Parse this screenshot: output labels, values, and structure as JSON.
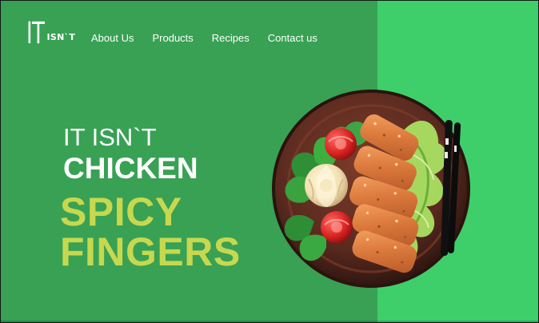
{
  "brand": {
    "logo_main": "IT",
    "logo_sub": "ISN`T"
  },
  "nav": {
    "items": [
      {
        "label": "About Us"
      },
      {
        "label": "Products"
      },
      {
        "label": "Recipes"
      },
      {
        "label": "Contact us"
      }
    ]
  },
  "hero": {
    "line1": "IT ISN`T",
    "line2": "CHICKEN",
    "product_line1": "SPICY",
    "product_line2": "FINGERS"
  },
  "colors": {
    "left_background": "#38a154",
    "right_background": "#3fcf6a",
    "headline_text": "#ffffff",
    "product_text": "#c7d84f",
    "plate": "#5b2a1e"
  },
  "image": {
    "semantic": "plate-with-spicy-fingers"
  }
}
